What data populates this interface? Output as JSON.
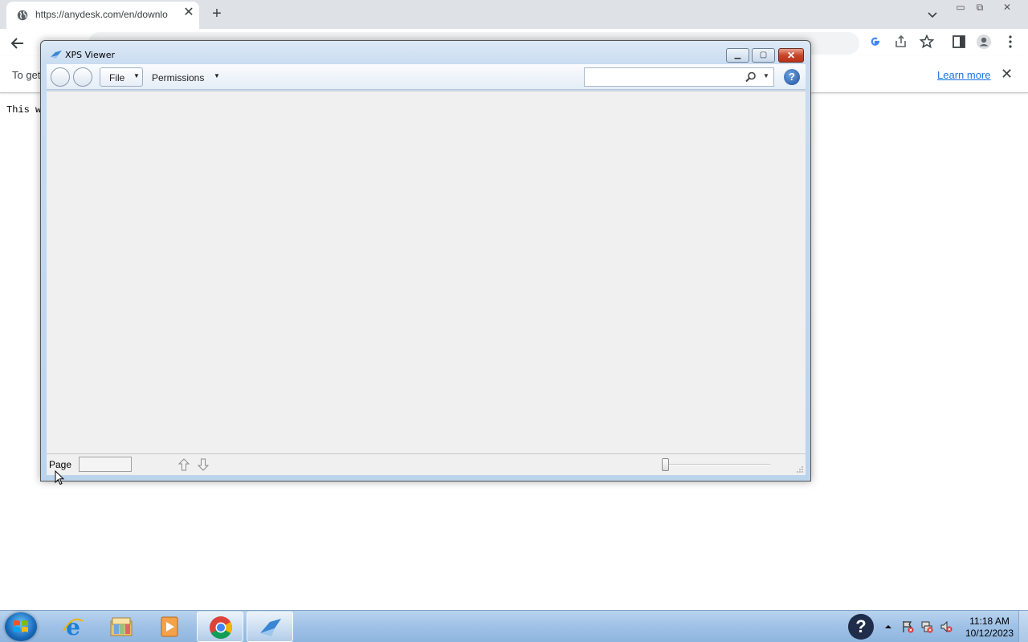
{
  "browser": {
    "tab_title": "https://anydesk.com/en/downlo",
    "infobar_message": "To get",
    "infobar_link": "Learn more",
    "page_text": "This w"
  },
  "xps_window": {
    "title": "XPS Viewer",
    "toolbar": {
      "file_label": "File",
      "permissions_label": "Permissions",
      "search_placeholder": ""
    },
    "status": {
      "page_label": "Page",
      "page_value": ""
    }
  },
  "taskbar": {
    "apps": [
      "start-button",
      "internet-explorer",
      "windows-explorer",
      "media-player",
      "google-chrome",
      "xps-viewer"
    ],
    "clock_time": "11:18 AM",
    "clock_date": "10/12/2023"
  },
  "colors": {
    "chrome_accent": "#1a73e8",
    "xps_frame": "#c9dcf0",
    "taskbar": "#9fc1e6"
  }
}
